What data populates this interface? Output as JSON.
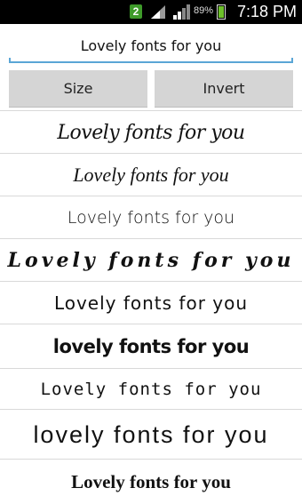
{
  "status_bar": {
    "notification_badge": "2",
    "battery_percent": "89%",
    "time": "7:18 PM"
  },
  "input": {
    "value": "Lovely fonts for you"
  },
  "buttons": {
    "size_label": "Size",
    "invert_label": "Invert"
  },
  "font_previews": [
    "Lovely fonts for you",
    "Lovely fonts for you",
    "Lovely fonts for you",
    "Lovely fonts for you",
    "Lovely fonts for you",
    "lovely fonts for you",
    "Lovely fonts for you",
    "lovely fonts for you",
    "Lovely fonts for you"
  ]
}
